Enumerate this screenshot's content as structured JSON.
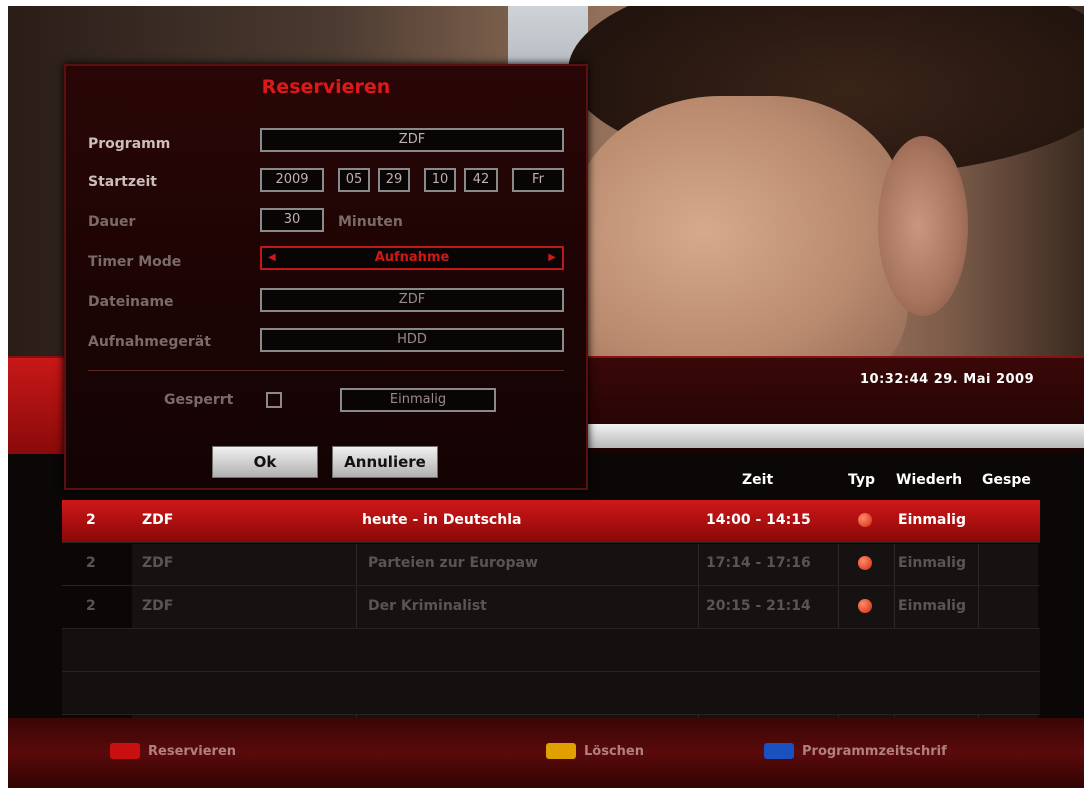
{
  "dialog": {
    "title": "Reservieren",
    "program_label": "Programm",
    "program_value": "ZDF",
    "start_label": "Startzeit",
    "start_year": "2009",
    "start_month": "05",
    "start_day": "29",
    "start_hour": "10",
    "start_minute": "42",
    "start_weekday": "Fr",
    "duration_label": "Dauer",
    "duration_value": "30",
    "duration_unit": "Minuten",
    "timer_mode_label": "Timer Mode",
    "timer_mode_value": "Aufnahme",
    "filename_label": "Dateiname",
    "filename_value": "ZDF",
    "device_label": "Aufnahmegerät",
    "device_value": "HDD",
    "locked_label": "Gesperrt",
    "repeat_value": "Einmalig",
    "ok_label": "Ok",
    "cancel_label": "Annuliere"
  },
  "info_bar": {
    "clock": "10:32:44  29. Mai 2009"
  },
  "list": {
    "headers": {
      "zeit": "Zeit",
      "typ": "Typ",
      "wiederh": "Wiederh",
      "gespe": "Gespe"
    },
    "rows": [
      {
        "num": "2",
        "channel": "ZDF",
        "title": "heute - in Deutschla",
        "time": "14:00 - 14:15",
        "repeat": "Einmalig"
      },
      {
        "num": "2",
        "channel": "ZDF",
        "title": "Parteien zur Europaw",
        "time": "17:14 - 17:16",
        "repeat": "Einmalig"
      },
      {
        "num": "2",
        "channel": "ZDF",
        "title": "Der Kriminalist",
        "time": "20:15 - 21:14",
        "repeat": "Einmalig"
      }
    ]
  },
  "footer": {
    "red_label": "Reservieren",
    "yellow_label": "Löschen",
    "blue_label": "Programmzeitschrif"
  },
  "colors": {
    "accent_red": "#d01818",
    "yellow_key": "#e0a000",
    "blue_key": "#1a50c0",
    "red_key": "#c81010"
  }
}
